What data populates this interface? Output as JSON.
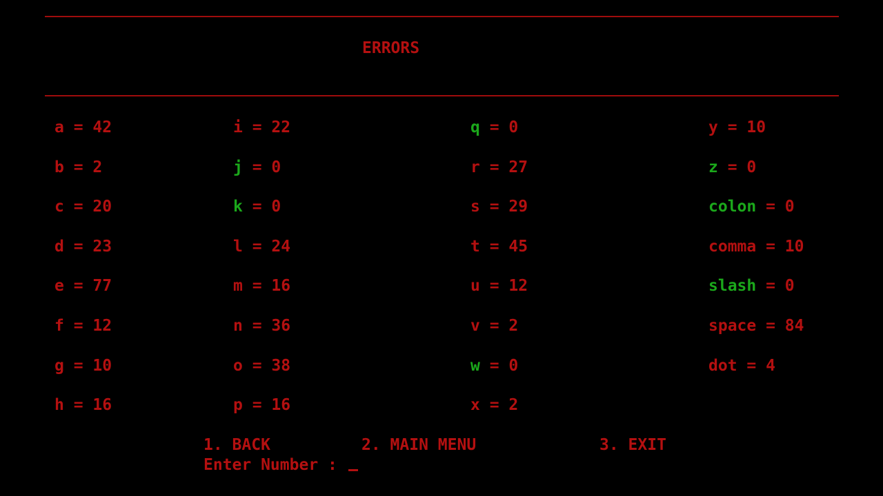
{
  "title": "ERRORS",
  "colors": {
    "background": "#000000",
    "error": "#b41010",
    "zero": "#1ba81b"
  },
  "errors": [
    {
      "char": "a",
      "count": "42"
    },
    {
      "char": "b",
      "count": "2"
    },
    {
      "char": "c",
      "count": "20"
    },
    {
      "char": "d",
      "count": "23"
    },
    {
      "char": "e",
      "count": "77"
    },
    {
      "char": "f",
      "count": "12"
    },
    {
      "char": "g",
      "count": "10"
    },
    {
      "char": "h",
      "count": "16"
    },
    {
      "char": "i",
      "count": "22"
    },
    {
      "char": "j",
      "count": "0"
    },
    {
      "char": "k",
      "count": "0"
    },
    {
      "char": "l",
      "count": "24"
    },
    {
      "char": "m",
      "count": "16"
    },
    {
      "char": "n",
      "count": "36"
    },
    {
      "char": "o",
      "count": "38"
    },
    {
      "char": "p",
      "count": "16"
    },
    {
      "char": "q",
      "count": "0"
    },
    {
      "char": "r",
      "count": "27"
    },
    {
      "char": "s",
      "count": "29"
    },
    {
      "char": "t",
      "count": "45"
    },
    {
      "char": "u",
      "count": "12"
    },
    {
      "char": "v",
      "count": "2"
    },
    {
      "char": "w",
      "count": "0"
    },
    {
      "char": "x",
      "count": "2"
    },
    {
      "char": "y",
      "count": "10"
    },
    {
      "char": "z",
      "count": "0"
    },
    {
      "char": "colon",
      "count": "0"
    },
    {
      "char": "comma",
      "count": "10"
    },
    {
      "char": "slash",
      "count": "0"
    },
    {
      "char": "space",
      "count": "84"
    },
    {
      "char": "dot",
      "count": "4"
    }
  ],
  "menu": {
    "back": "1. BACK",
    "main_menu": "2. MAIN MENU",
    "exit": "3. EXIT"
  },
  "prompt": "Enter Number : "
}
